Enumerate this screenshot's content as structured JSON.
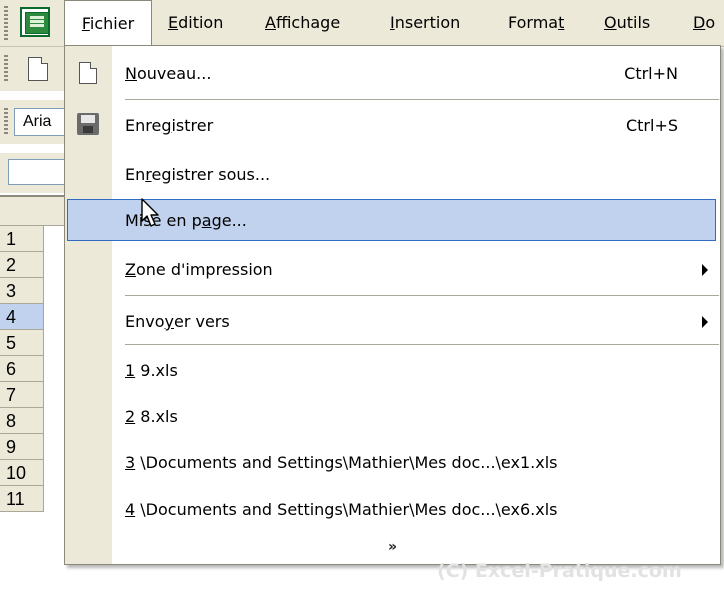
{
  "menubar": {
    "items": [
      {
        "label": "Fichier",
        "mnemonic_index": 0
      },
      {
        "label": "Edition",
        "mnemonic_index": 0
      },
      {
        "label": "Affichage",
        "mnemonic_index": 0
      },
      {
        "label": "Insertion",
        "mnemonic_index": 0
      },
      {
        "label": "Format",
        "mnemonic_index": 5
      },
      {
        "label": "Outils",
        "mnemonic_index": 0
      },
      {
        "label": "Do",
        "mnemonic_index": 0
      }
    ],
    "icon": "excel-app-icon"
  },
  "toolbar": {
    "font_name": "Aria",
    "new_icon": "new-document-icon"
  },
  "grid": {
    "rows": [
      "1",
      "2",
      "3",
      "4",
      "5",
      "6",
      "7",
      "8",
      "9",
      "10",
      "11"
    ],
    "active_row": "4"
  },
  "menu": {
    "items": [
      {
        "label": "Nouveau...",
        "mnemonic_index": 0,
        "shortcut": "Ctrl+N",
        "icon": "new-document-icon"
      },
      {
        "label": "Enregistrer",
        "mnemonic_index": 4,
        "shortcut": "Ctrl+S",
        "icon": "save-icon"
      },
      {
        "label": "Enregistrer sous...",
        "mnemonic_index": 2,
        "shortcut": ""
      },
      {
        "label": "Mise en page...",
        "mnemonic_index": 9,
        "shortcut": "",
        "highlighted": true
      },
      {
        "label": "Zone d'impression",
        "mnemonic_index": 0,
        "shortcut": "",
        "submenu": true
      },
      {
        "label": "Envoyer vers",
        "mnemonic_index": 4,
        "shortcut": "",
        "submenu": true
      },
      {
        "label": "1 9.xls",
        "mnemonic_index": 0,
        "shortcut": ""
      },
      {
        "label": "2 8.xls",
        "mnemonic_index": 0,
        "shortcut": ""
      },
      {
        "label": "3 \\Documents and Settings\\Mathier\\Mes doc...\\ex1.xls",
        "mnemonic_index": 0,
        "shortcut": ""
      },
      {
        "label": "4 \\Documents and Settings\\Mathier\\Mes doc...\\ex6.xls",
        "mnemonic_index": 0,
        "shortcut": ""
      }
    ],
    "expand_glyph": "»",
    "expand_icon": "double-chevron-down-icon"
  },
  "watermark": "(C) Excel-Pratique.com",
  "colors": {
    "chrome": "#ece9d8",
    "highlight_fill": "#c1d2ee",
    "highlight_border": "#316ac5",
    "separator": "#aca899"
  }
}
